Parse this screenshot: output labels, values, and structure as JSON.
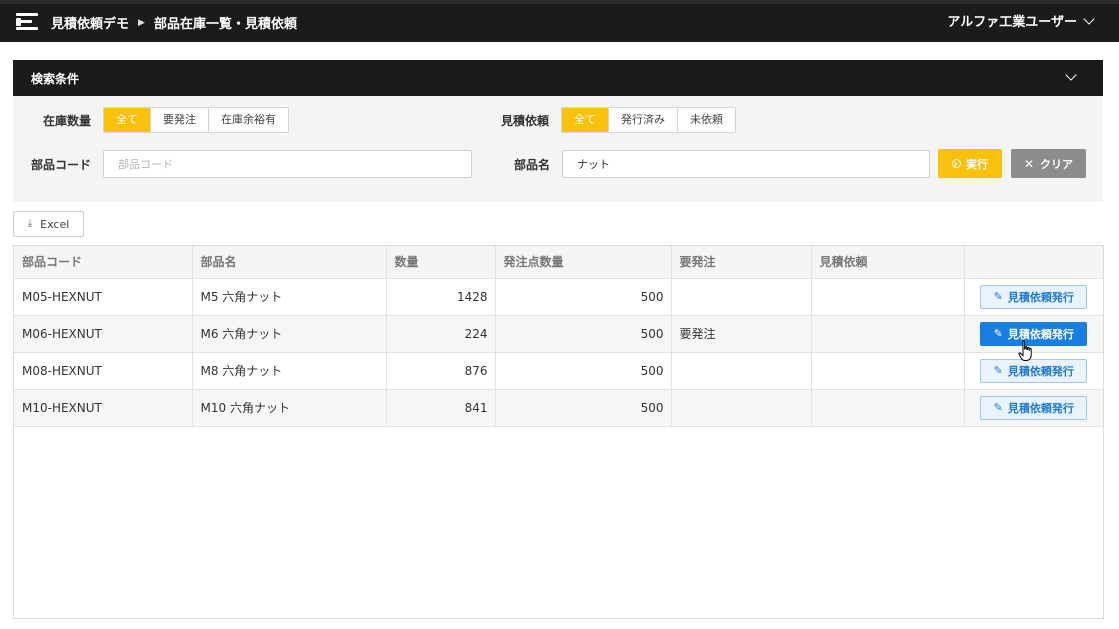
{
  "app": {
    "title": "見積依頼デモ",
    "page": "部品在庫一覧・見積依頼",
    "user": "アルファ工業ユーザー"
  },
  "search": {
    "title": "検索条件",
    "stock_label": "在庫数量",
    "stock_options": [
      "全て",
      "要発注",
      "在庫余裕有"
    ],
    "stock_selected": "全て",
    "quote_label": "見積依頼",
    "quote_options": [
      "全て",
      "発行済み",
      "未依頼"
    ],
    "quote_selected": "全て",
    "code_label": "部品コード",
    "code_value": "",
    "code_placeholder": "部品コード",
    "name_label": "部品名",
    "name_value": "ナット",
    "run_label": "実行",
    "clear_label": "クリア"
  },
  "toolbar": {
    "excel_label": "Excel"
  },
  "table": {
    "columns": [
      "部品コード",
      "部品名",
      "数量",
      "発注点数量",
      "要発注",
      "見積依頼",
      ""
    ],
    "rows": [
      {
        "code": "M05-HEXNUT",
        "name": "M5 六角ナット",
        "qty": "1428",
        "reorder": "500",
        "need": "",
        "quote": "",
        "action": "見積依頼発行"
      },
      {
        "code": "M06-HEXNUT",
        "name": "M6 六角ナット",
        "qty": "224",
        "reorder": "500",
        "need": "要発注",
        "quote": "",
        "action": "見積依頼発行"
      },
      {
        "code": "M08-HEXNUT",
        "name": "M8 六角ナット",
        "qty": "876",
        "reorder": "500",
        "need": "",
        "quote": "",
        "action": "見積依頼発行"
      },
      {
        "code": "M10-HEXNUT",
        "name": "M10 六角ナット",
        "qty": "841",
        "reorder": "500",
        "need": "",
        "quote": "",
        "action": "見積依頼発行"
      }
    ]
  },
  "colors": {
    "accent": "#f9c00c",
    "primary": "#1a7ee0",
    "header": "#1b1b1b"
  }
}
